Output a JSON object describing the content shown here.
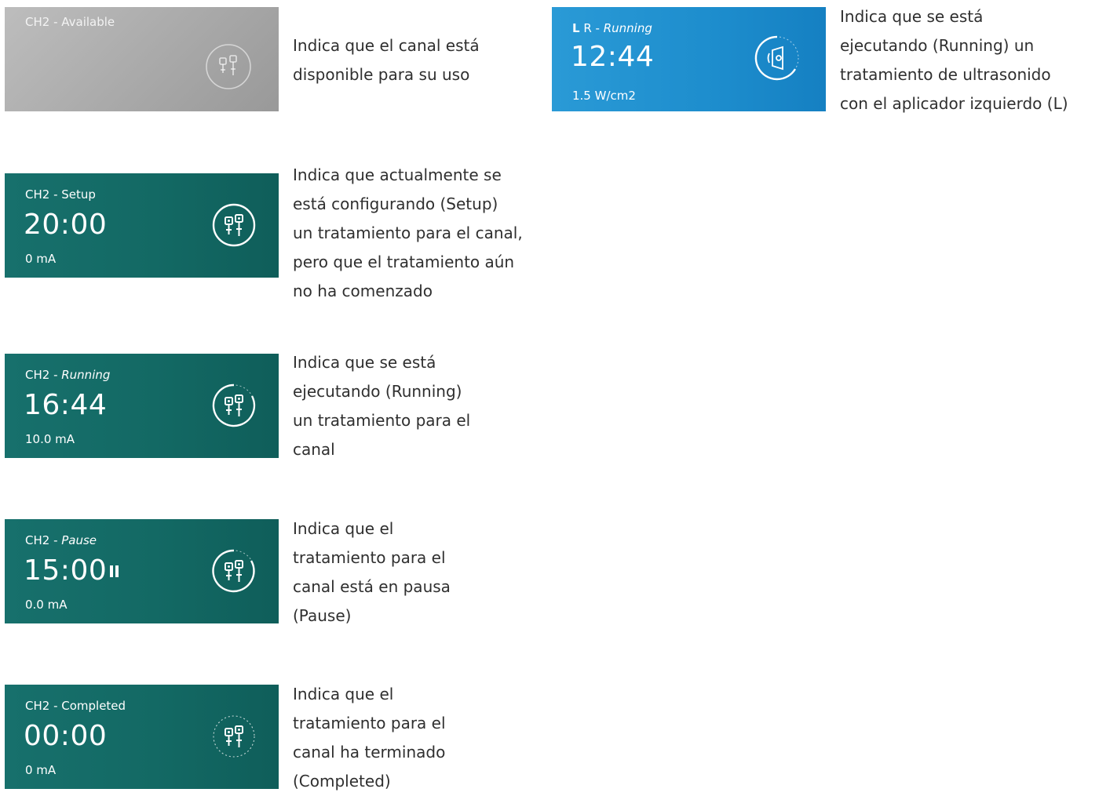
{
  "items": [
    {
      "channel": "CH2",
      "separator": " - ",
      "state": "Available",
      "time": "",
      "value": "",
      "description": [
        "Indica que el canal está",
        "disponible para su uso"
      ]
    },
    {
      "channel": "CH2",
      "separator": " - ",
      "state": "Setup",
      "time": "20:00",
      "value": "0 mA",
      "description": [
        "Indica que actualmente se",
        "está configurando (Setup)",
        "un tratamiento para el canal,",
        "pero que el tratamiento aún",
        "no ha comenzado"
      ]
    },
    {
      "channel": "CH2",
      "separator": " - ",
      "state": "Running",
      "time": "16:44",
      "value": "10.0 mA",
      "description": [
        "Indica que se está",
        "ejecutando (Running)",
        "un tratamiento para el",
        "canal"
      ]
    },
    {
      "channel": "CH2",
      "separator": " - ",
      "state": "Pause",
      "time": "15:00",
      "value": "0.0 mA",
      "description": [
        "Indica que el",
        "tratamiento para el",
        "canal está en pausa",
        "(Pause)"
      ]
    },
    {
      "channel": "CH2",
      "separator": " - ",
      "state": "Completed",
      "time": "00:00",
      "value": "0 mA",
      "description": [
        "Indica que el",
        "tratamiento para el",
        "canal ha terminado",
        "(Completed)"
      ]
    },
    {
      "applicator_left": "L",
      "applicator_right": " R",
      "separator": " - ",
      "state": "Running",
      "time": "12:44",
      "value": "1.5 W/cm2",
      "description": [
        "Indica que se está",
        "ejecutando (Running) un",
        "tratamiento de ultrasonido",
        "con el aplicador izquierdo (L)"
      ]
    }
  ],
  "colors": {
    "teal": "#136964",
    "gray": "#a9a9a9",
    "blue": "#1d8dcd",
    "text": "#2f2f2f"
  },
  "icons": {
    "electrodes": "electrodes-icon",
    "ultrasound": "ultrasound-icon",
    "pause": "pause-icon"
  }
}
